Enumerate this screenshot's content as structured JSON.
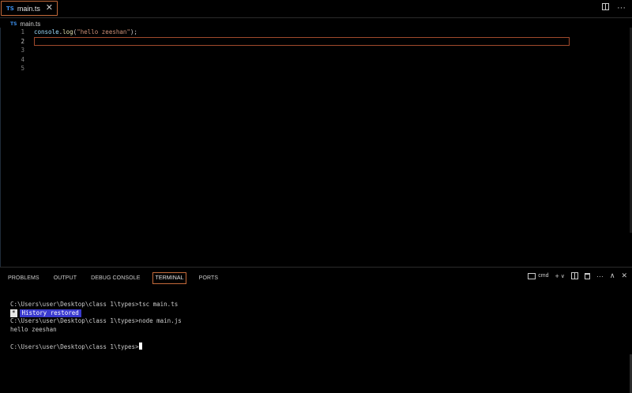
{
  "tabs": [
    {
      "badge": "TS",
      "label": "main.ts",
      "close_glyph": "✕"
    }
  ],
  "tabbar_actions": {
    "split_icon": "split-editor-icon",
    "more_glyph": "···"
  },
  "breadcrumb": {
    "badge": "TS",
    "label": "main.ts"
  },
  "editor": {
    "line_numbers": [
      "1",
      "2",
      "3",
      "4",
      "5"
    ],
    "active_line": 2,
    "line1": {
      "obj": "console",
      "dot": ".",
      "fn": "log",
      "open": "(",
      "str": "\"hello zeeshan\"",
      "close": ");"
    }
  },
  "panel": {
    "tabs": [
      "PROBLEMS",
      "OUTPUT",
      "DEBUG CONSOLE",
      "TERMINAL",
      "PORTS"
    ],
    "active_tab": "TERMINAL",
    "actions": {
      "shell_label": "cmd",
      "add_glyph": "+",
      "dropdown_glyph": "∨",
      "more_glyph": "···",
      "maximize_glyph": "∧",
      "close_glyph": "✕"
    }
  },
  "terminal": {
    "lines": [
      "C:\\Users\\user\\Desktop\\class 1\\types>tsc main.ts",
      "C:\\Users\\user\\Desktop\\class 1\\types>node main.js",
      "hello zeeshan",
      "",
      "C:\\Users\\user\\Desktop\\class 1\\types>"
    ],
    "history_star": "*",
    "history_text": "History restored"
  }
}
